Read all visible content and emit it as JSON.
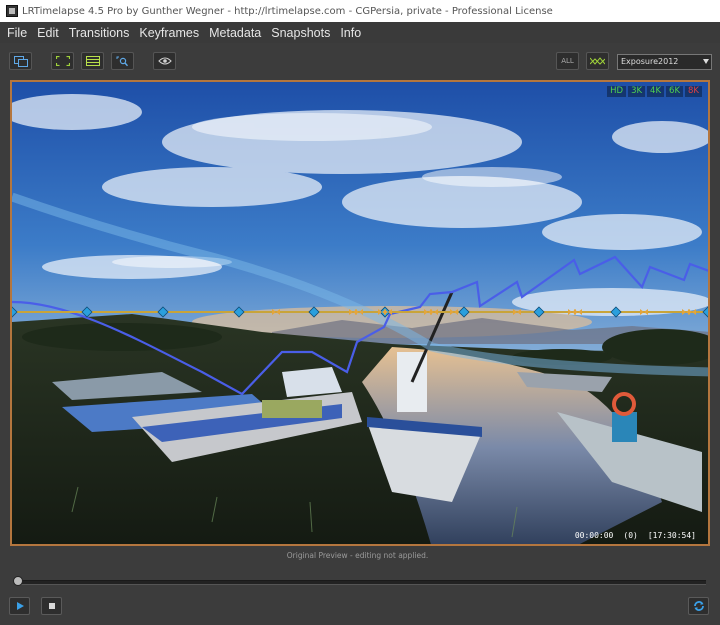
{
  "window": {
    "title": "LRTimelapse 4.5 Pro by Gunther Wegner - http://lrtimelapse.com - CGPersia, private - Professional License"
  },
  "menu": {
    "items": [
      "File",
      "Edit",
      "Transitions",
      "Keyframes",
      "Metadata",
      "Snapshots",
      "Info"
    ]
  },
  "toolbar": {
    "all_label": "ALL",
    "process_version": "Exposure2012"
  },
  "preview": {
    "resolutions": [
      "HD",
      "3K",
      "4K",
      "6K",
      "8K"
    ],
    "timecode": "00:00:00",
    "frame_index": "(0)",
    "clock": "[17:30:54]"
  },
  "status": {
    "text": "Original Preview - editing not applied."
  },
  "playback": {
    "position_fraction": 0
  },
  "colors": {
    "accent_frame": "#b4763e",
    "keyframe_marker": "#2a9fdd",
    "curve_blue": "#4a5ee8",
    "resolution_ok": "#4fd24f",
    "resolution_exceeded": "#e04040"
  },
  "icons": {
    "toolbar": [
      "filmstrip-icon",
      "crop-frame-icon",
      "grid-lines-icon",
      "zoom-icon",
      "eye-icon",
      "curve-toggle-icon"
    ],
    "playback": [
      "play-icon",
      "stop-icon",
      "loop-icon"
    ]
  }
}
